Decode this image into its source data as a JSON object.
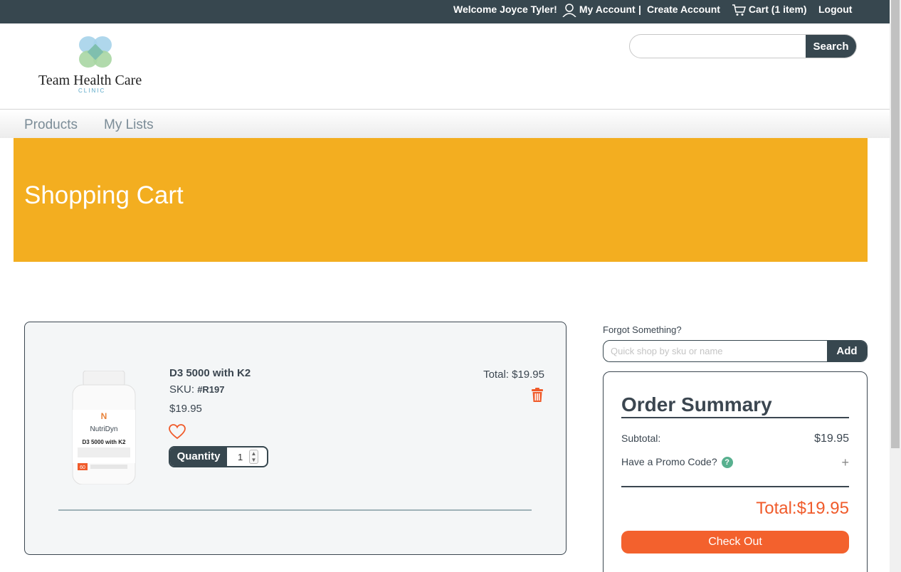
{
  "topbar": {
    "welcome": "Welcome Joyce Tyler!",
    "my_account": "My Account",
    "separator": "|",
    "create_account": "Create Account",
    "cart": "Cart (1 item)",
    "logout": "Logout"
  },
  "header": {
    "logo_name": "Team Health Care",
    "logo_sub": "CLINIC",
    "search_placeholder": "",
    "search_button": "Search"
  },
  "nav": {
    "items": [
      {
        "label": "Products"
      },
      {
        "label": "My Lists"
      }
    ]
  },
  "banner": {
    "title": "Shopping Cart"
  },
  "cart": {
    "item": {
      "name": "D3 5000 with K2",
      "sku_label": "SKU:",
      "sku_value": "#R197",
      "price": "$19.95",
      "quantity_label": "Quantity",
      "quantity_value": "1",
      "line_total": "Total: $19.95",
      "bottle_brand": "NutriDyn",
      "bottle_product": "D3 5000 with K2",
      "bottle_count": "60"
    }
  },
  "quick_shop": {
    "title": "Forgot Something?",
    "placeholder": "Quick shop by sku or name",
    "button": "Add"
  },
  "summary": {
    "title": "Order Summary",
    "subtotal_label": "Subtotal:",
    "subtotal_value": "$19.95",
    "promo_label": "Have a Promo Code?",
    "promo_help": "?",
    "promo_toggle": "+",
    "total": "Total:$19.95",
    "checkout": "Check Out"
  },
  "colors": {
    "topbar": "#37474f",
    "banner": "#f3ae20",
    "accent": "#f3612d",
    "help": "#58b08f"
  }
}
